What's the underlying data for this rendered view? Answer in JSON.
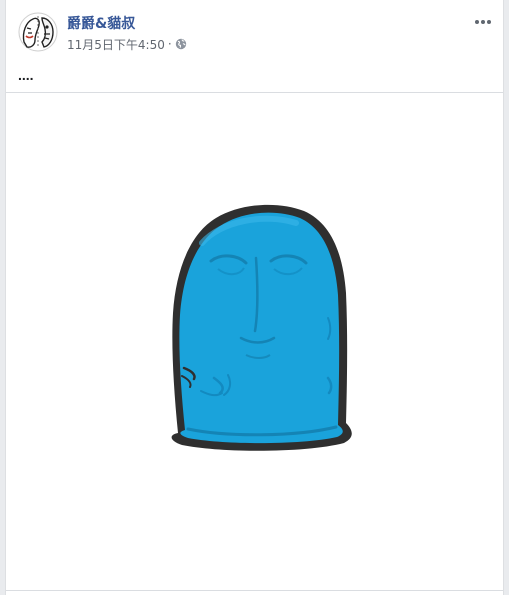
{
  "post": {
    "author": "爵爵&貓叔",
    "timestamp": "11月5日下午4:50",
    "separator": "·",
    "privacy_icon": "globe-icon",
    "more_icon": "more-options-icon",
    "text": "....",
    "image_subject": "blue-thumb-character"
  },
  "colors": {
    "author_link": "#385898",
    "meta_text": "#616770",
    "character_fill": "#1aa3db",
    "character_outline": "#2f2f2f"
  }
}
